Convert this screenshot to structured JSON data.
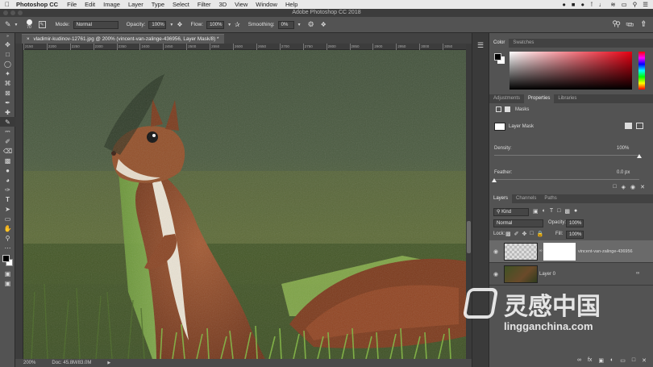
{
  "menubar": {
    "app_name": "Photoshop CC",
    "items": [
      "File",
      "Edit",
      "Image",
      "Layer",
      "Type",
      "Select",
      "Filter",
      "3D",
      "View",
      "Window",
      "Help"
    ]
  },
  "window": {
    "title": "Adobe Photoshop CC 2018"
  },
  "options": {
    "brush_size": "70",
    "mode_label": "Mode:",
    "mode_value": "Normal",
    "opacity_label": "Opacity:",
    "opacity_value": "100%",
    "flow_label": "Flow:",
    "flow_value": "100%",
    "smoothing_label": "Smoothing:",
    "smoothing_value": "0%"
  },
  "document": {
    "tab_title": "vladimir-kudinov-12761.jpg @ 200% (vincent-van-zalinge-436956, Layer Mask/8) *",
    "ruler_ticks": [
      "2150",
      "2200",
      "2250",
      "2300",
      "2350",
      "2400",
      "2450",
      "2500",
      "2550",
      "2600",
      "2650",
      "2700",
      "2750",
      "2800",
      "2850",
      "2900",
      "2950",
      "3000",
      "3050"
    ]
  },
  "status": {
    "zoom": "200%",
    "doc": "Doc: 45.8M/83.0M"
  },
  "color_panel": {
    "tabs": [
      "Color",
      "Swatches"
    ]
  },
  "properties_panel": {
    "tabs": [
      "Adjustments",
      "Properties",
      "Libraries"
    ],
    "section": "Masks",
    "mask_type": "Layer Mask",
    "density_label": "Density:",
    "density_value": "100%",
    "density_level": 1.0,
    "feather_label": "Feather:",
    "feather_value": "0.0 px",
    "feather_level": 0.0
  },
  "layers_panel": {
    "tabs": [
      "Layers",
      "Channels",
      "Paths"
    ],
    "filter_kind": "Kind",
    "blend_mode": "Normal",
    "opacity_label": "Opacity:",
    "opacity_value": "100%",
    "lock_label": "Lock:",
    "fill_label": "Fill:",
    "fill_value": "100%",
    "layers": [
      {
        "name": "vincent-van-zalinge-436956",
        "selected": true
      },
      {
        "name": "Layer 0",
        "selected": false
      }
    ]
  },
  "watermark": {
    "cn": "灵感中国",
    "url": "lingganchina.com"
  },
  "colors": {
    "panel_bg": "#535353",
    "dark_bg": "#282828",
    "accent_red": "#e60012"
  }
}
